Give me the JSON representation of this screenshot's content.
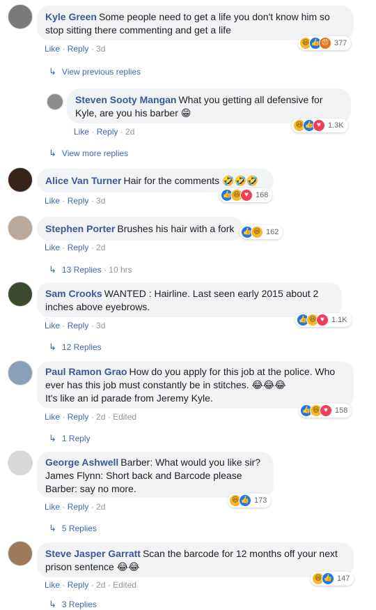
{
  "labels": {
    "like": "Like",
    "reply": "Reply",
    "sep": " · ",
    "edited": "Edited"
  },
  "comments": [
    {
      "name": "Kyle Green",
      "text": "Some people need to get a life you don't know him so stop sitting there commenting and get a life",
      "time": "3d",
      "reaction_count": "377"
    },
    {
      "name": "Steven Sooty Mangan",
      "text": "What you getting all defensive for Kyle, are you his barber 😁",
      "time": "2d",
      "reaction_count": "1.3K"
    },
    {
      "name": "Alice Van Turner",
      "text": "Hair for the comments 🤣🤣🤣",
      "time": "3d",
      "reaction_count": "168"
    },
    {
      "name": "Stephen Porter",
      "text": "Brushes his hair with a fork",
      "time": "2d",
      "reaction_count": "162"
    },
    {
      "name": "Sam Crooks",
      "text": "WANTED : Hairline. Last seen early 2015 about 2 inches above eyebrows.",
      "time": "3d",
      "reaction_count": "1.1K"
    },
    {
      "name": "Paul Ramon Grao",
      "text": "How do you apply for this job at the police. Who ever has this job must constantly be in stitches. 😂😂😂",
      "text2": "It's like an id parade from Jeremy Kyle.",
      "time": "2d",
      "reaction_count": "158"
    },
    {
      "name": "George Ashwell",
      "text": "Barber: What would you like sir?",
      "text2": "James Flynn: Short back and Barcode please",
      "text3": "Barber: say no more.",
      "time": "2d",
      "reaction_count": "173"
    },
    {
      "name": "Steve Jasper Garratt",
      "text": "Scan the barcode for 12 months off your next prison sentence 😂😂",
      "time": "2d",
      "reaction_count": "147"
    }
  ],
  "reply_links": {
    "view_previous": "View previous replies",
    "view_more": "View more replies",
    "stephen": "13 Replies",
    "stephen_time": "10 hrs",
    "sam": "12 Replies",
    "paul": "1 Reply",
    "george": "5 Replies",
    "steve": "3 Replies"
  },
  "icons": {
    "arrow": "reply-arrow-icon",
    "like": "like-reaction-icon",
    "haha": "haha-reaction-icon",
    "love": "love-reaction-icon",
    "angry": "angry-reaction-icon"
  },
  "colors": {
    "name": "#385898",
    "link": "#4267b2",
    "bubble": "#f2f3f5",
    "like": "#1877f2",
    "haha": "#f7b928",
    "love": "#f33e58",
    "angry": "#e9710f"
  }
}
